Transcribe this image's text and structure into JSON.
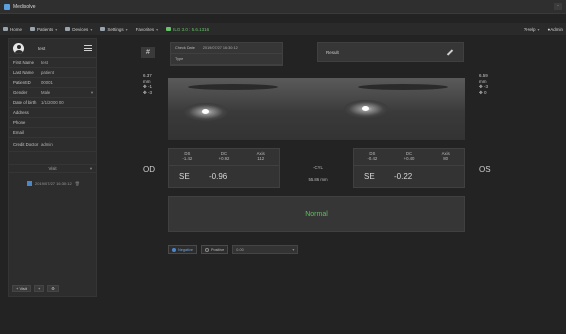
{
  "window": {
    "title": "Medisolve",
    "control": "-"
  },
  "menu": {
    "items": [
      {
        "label": "Home",
        "icon": "home-icon"
      },
      {
        "label": "Patients",
        "icon": "patients-icon",
        "caret": true
      },
      {
        "label": "Devices",
        "icon": "devices-icon",
        "caret": true
      },
      {
        "label": "Settings",
        "icon": "settings-icon",
        "caret": true
      },
      {
        "label": "Favorites",
        "caret": true
      }
    ],
    "status": "ILG 3.0 : 5.6.1316",
    "right": [
      {
        "label": "Help",
        "caret": true
      },
      {
        "label": "Admin"
      }
    ]
  },
  "sidebar": {
    "profile_name": "test",
    "fields": [
      {
        "label": "First Name",
        "value": "test"
      },
      {
        "label": "Last Name",
        "value": "patient"
      },
      {
        "label": "PatientID",
        "value": "00001"
      },
      {
        "label": "Gender",
        "value": "Male",
        "dropdown": true
      },
      {
        "label": "Date of birth",
        "value": "1/1/2000 00"
      },
      {
        "label": "Address",
        "value": ""
      },
      {
        "label": "Phone",
        "value": ""
      },
      {
        "label": "Email",
        "value": ""
      },
      {
        "label": "Credit Doctor",
        "value": "admin"
      }
    ],
    "visits_header": "Visit",
    "visit_item": "2019/07/27 16:30:12",
    "bottom_buttons": [
      "+ Visit",
      "+",
      "⚙"
    ]
  },
  "main": {
    "hash_label": "#",
    "check_date_label": "Check Date",
    "check_date_value": "2019/07/27 16:30:12",
    "type_label": "Type",
    "result_label": "Result",
    "left_side": {
      "mm": "6.37",
      "unit": "mm",
      "a1": "-1",
      "a2": "-3"
    },
    "right_side": {
      "mm": "6.59",
      "unit": "mm",
      "a1": "-3",
      "a2": "0"
    },
    "od": "OD",
    "os": "OS",
    "od_panel": {
      "ds_label": "DS",
      "ds": "-1.42",
      "dc_label": "DC",
      "dc": "+0.92",
      "axis_label": "Axis",
      "axis": "112",
      "se_label": "SE",
      "se": "-0.96"
    },
    "os_panel": {
      "ds_label": "DS",
      "ds": "-0.42",
      "dc_label": "DC",
      "dc": "+0.40",
      "axis_label": "Axis",
      "axis": "80",
      "se_label": "SE",
      "se": "-0.22"
    },
    "center": {
      "cyl": "-CYL",
      "pd": "55.86 mm"
    },
    "diagnosis": "Normal",
    "controls": {
      "opt1": "Negative",
      "opt2": "Positive",
      "select_value": "0.00"
    }
  },
  "colors": {
    "background": "#232323",
    "panel": "#363636",
    "normal_green": "#5fbf5f",
    "accent_blue": "#4a86c8"
  }
}
